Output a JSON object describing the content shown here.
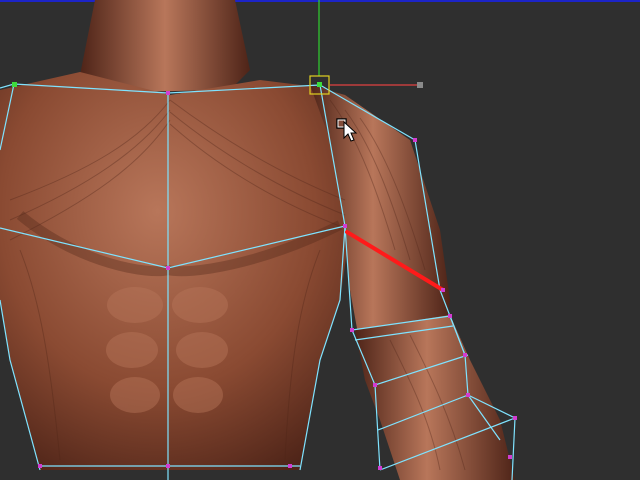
{
  "viewport": {
    "background": "#2f2f2f",
    "top_edge_color": "#1c24c8"
  },
  "model": {
    "skin_base": "#8a4a32",
    "skin_light": "#b8765a",
    "skin_dark": "#4e2418"
  },
  "wireframe": {
    "edge_color": "#7fe3ff",
    "vertex_color": "#d23cd2",
    "anchor_vertex_color": "#3cdc3c",
    "selected_edge_color": "#ff1a1a"
  },
  "gizmo": {
    "x_axis_color": "#e04040",
    "y_axis_color": "#30d030",
    "center_box_color": "#e0d020",
    "handle_color": "#8a8a8a"
  },
  "cursor": {
    "icon": "pointer-move-icon"
  }
}
